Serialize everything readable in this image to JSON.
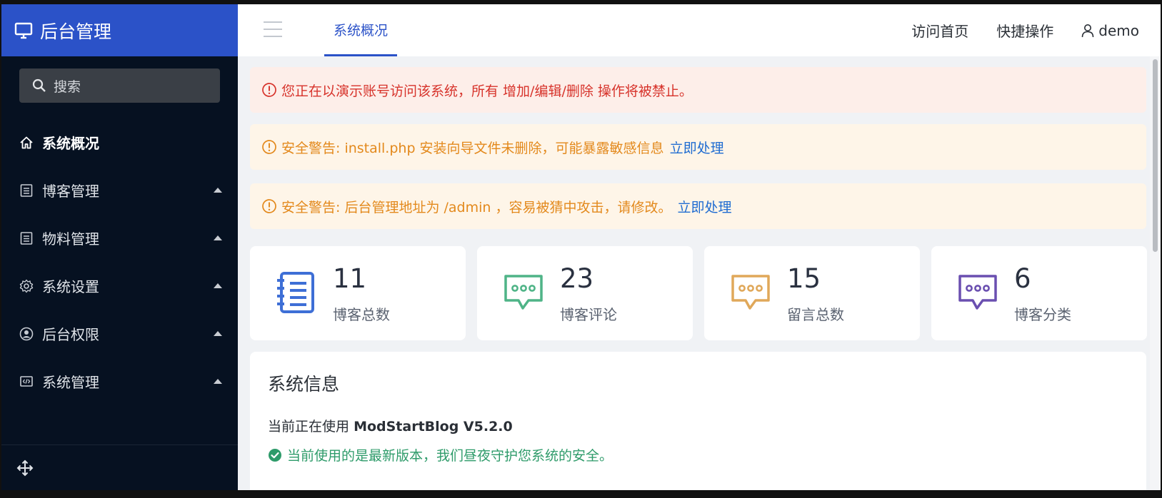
{
  "brand": {
    "title": "后台管理",
    "icon": "monitor-icon",
    "color": "#2b52c8"
  },
  "search": {
    "label": "搜索",
    "icon": "search-icon"
  },
  "sidebar": {
    "items": [
      {
        "label": "系统概况",
        "icon": "home-icon",
        "active": true
      },
      {
        "label": "博客管理",
        "icon": "list-icon",
        "expandable": true
      },
      {
        "label": "物料管理",
        "icon": "list-icon",
        "expandable": true
      },
      {
        "label": "系统设置",
        "icon": "gear-icon",
        "expandable": true
      },
      {
        "label": "后台权限",
        "icon": "user-circle-icon",
        "expandable": true
      },
      {
        "label": "系统管理",
        "icon": "code-icon",
        "expandable": true
      }
    ],
    "footer_icon": "move-icon"
  },
  "header": {
    "menu_icon": "hamburger-icon",
    "active_tab": "系统概况",
    "links": [
      "访问首页",
      "快捷操作"
    ],
    "user": "demo"
  },
  "alerts": [
    {
      "type": "danger",
      "text": "您正在以演示账号访问该系统，所有 增加/编辑/删除 操作将被禁止。",
      "link": ""
    },
    {
      "type": "warning",
      "text": "安全警告: install.php 安装向导文件未删除，可能暴露敏感信息",
      "link": "立即处理"
    },
    {
      "type": "warning",
      "text": "安全警告: 后台管理地址为 /admin ，容易被猜中攻击，请修改。",
      "link": "立即处理"
    }
  ],
  "stats": [
    {
      "value": "11",
      "label": "博客总数",
      "icon": "notebook-icon",
      "color": "#3e6fd6"
    },
    {
      "value": "23",
      "label": "博客评论",
      "icon": "comment-icon",
      "color": "#4fb487"
    },
    {
      "value": "15",
      "label": "留言总数",
      "icon": "comment-icon",
      "color": "#e0a85a"
    },
    {
      "value": "6",
      "label": "博客分类",
      "icon": "comment-icon",
      "color": "#6a4fb0"
    }
  ],
  "system_info": {
    "title": "系统信息",
    "using_prefix": "当前正在使用",
    "product": "ModStartBlog V5.2.0",
    "status": "当前使用的是最新版本，我们昼夜守护您系统的安全。"
  }
}
